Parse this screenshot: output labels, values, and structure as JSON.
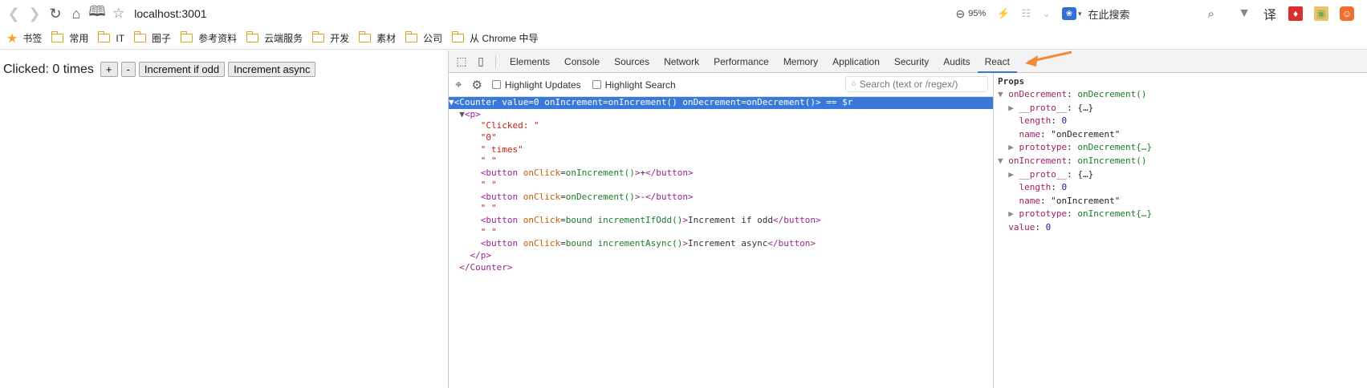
{
  "browser": {
    "address": "localhost:3001",
    "zoom": "95%",
    "search_placeholder": "在此搜索",
    "ext_translate": "译"
  },
  "bookmarks": [
    {
      "label": "书签",
      "type": "star"
    },
    {
      "label": "常用",
      "type": "folder"
    },
    {
      "label": "IT",
      "type": "folder"
    },
    {
      "label": "圈子",
      "type": "folder"
    },
    {
      "label": "参考资料",
      "type": "folder"
    },
    {
      "label": "云端服务",
      "type": "folder"
    },
    {
      "label": "开发",
      "type": "folder"
    },
    {
      "label": "素材",
      "type": "folder"
    },
    {
      "label": "公司",
      "type": "folder"
    },
    {
      "label": "从 Chrome 中导",
      "type": "folder"
    }
  ],
  "page": {
    "clicked_text": "Clicked: 0 times",
    "buttons": [
      "+",
      "-",
      "Increment if odd",
      "Increment async"
    ]
  },
  "devtools": {
    "tabs": [
      "Elements",
      "Console",
      "Sources",
      "Network",
      "Performance",
      "Memory",
      "Application",
      "Security",
      "Audits",
      "React"
    ],
    "active_tab": "React",
    "highlight_updates": "Highlight Updates",
    "highlight_search": "Highlight Search",
    "search_placeholder": "Search (text or /regex/)"
  },
  "tree": {
    "root_open": "<Counter",
    "root_attrs": " value=0 onIncrement=onIncrement() onDecrement=onDecrement()",
    "root_suffix": "> == $r",
    "p_open": "<p>",
    "s1": "\"Clicked: \"",
    "s2": "\"0\"",
    "s3": "\" times\"",
    "space": "\" \"",
    "b1_attr": "onClick",
    "b1_val": "onIncrement()",
    "b1_text": "+",
    "b2_val": "onDecrement()",
    "b2_text": "-",
    "b3_val": "bound incrementIfOdd()",
    "b3_text": "Increment if odd",
    "b4_val": "bound incrementAsync()",
    "b4_text": "Increment async",
    "p_close": "</p>",
    "root_close": "</Counter>"
  },
  "props": {
    "title": "Props",
    "onDecrement_key": "onDecrement",
    "onDecrement_val": "onDecrement()",
    "proto_key": "__proto__",
    "proto_val": "{…}",
    "length_key": "length",
    "length_val": "0",
    "name_key": "name",
    "name_dec": "\"onDecrement\"",
    "prototype_key": "prototype",
    "prototype_dec": "onDecrement{…}",
    "onIncrement_key": "onIncrement",
    "onIncrement_val": "onIncrement()",
    "name_inc": "\"onIncrement\"",
    "prototype_inc": "onIncrement{…}",
    "value_key": "value",
    "value_val": "0"
  },
  "colors": {
    "accent": "#3879d9",
    "annotation_arrow": "#f08a3a"
  }
}
